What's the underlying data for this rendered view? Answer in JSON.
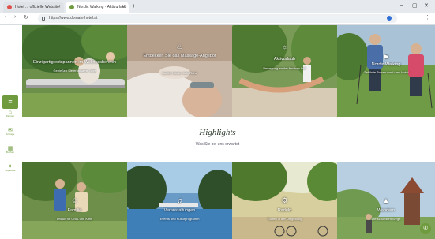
{
  "browser": {
    "tabs": [
      {
        "label": "Hotel ... offizielle Website",
        "active": false
      },
      {
        "label": "Nordic Walking · Aktivurlaub",
        "active": true
      }
    ],
    "url": "https://www.domain-hotel.at",
    "accent": "#6f9a3d"
  },
  "tiles_top": [
    {
      "title": "Einzigartig entspannen im Wellnessbereich",
      "subtitle": "Genießen Sie erholsame Tage",
      "icon": "spa-icon"
    },
    {
      "title": "Entdecken Sie das Massage-Angebot",
      "subtitle": "Sanfte Hände, tiefe Ruhe",
      "icon": "massage-icon"
    },
    {
      "title": "Aktivurlaub",
      "subtitle": "Bewegung an der frischen Luft",
      "icon": "hammock-icon"
    },
    {
      "title": "Nordic Walking",
      "subtitle": "Geführte Touren rund ums Hotel",
      "icon": "walking-icon"
    }
  ],
  "highlights": {
    "title": "Highlights",
    "subtitle": "Was Sie bei uns erwartet"
  },
  "tiles_bottom": [
    {
      "title": "Familie",
      "subtitle": "Urlaub für Groß und Klein",
      "icon": "family-icon"
    },
    {
      "title": "Veranstaltungen",
      "subtitle": "Events und Kulturprogramm",
      "icon": "music-icon"
    },
    {
      "title": "Radeln",
      "subtitle": "Touren in der Umgebung",
      "icon": "bike-icon"
    },
    {
      "title": "Wandern",
      "subtitle": "Die schönsten Wege",
      "icon": "hiking-icon"
    }
  ],
  "sidebar": {
    "menu_icon": "menu-icon",
    "items": [
      {
        "label": "Zimmer",
        "icon": "bed-icon"
      },
      {
        "label": "Anfrage",
        "icon": "mail-icon"
      },
      {
        "label": "Buchen",
        "icon": "calendar-icon"
      },
      {
        "label": "Angebote",
        "icon": "gift-icon"
      }
    ]
  }
}
